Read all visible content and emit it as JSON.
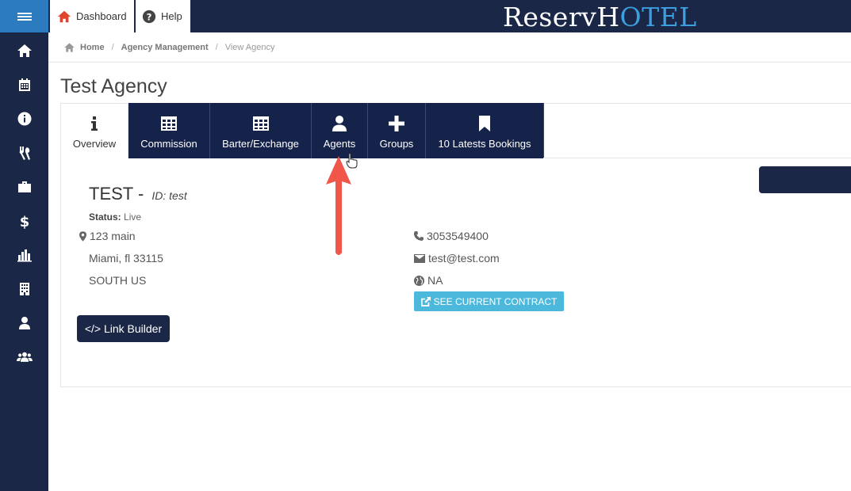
{
  "header": {
    "dashboard_label": "Dashboard",
    "help_label": "Help",
    "logo_part1": "ReservH",
    "logo_part2": "OTEL"
  },
  "sidebar": {
    "items": [
      {
        "icon": "home-icon"
      },
      {
        "icon": "calendar-icon"
      },
      {
        "icon": "info-icon"
      },
      {
        "icon": "utensils-icon"
      },
      {
        "icon": "briefcase-icon"
      },
      {
        "icon": "dollar-icon"
      },
      {
        "icon": "bar-chart-icon"
      },
      {
        "icon": "building-icon"
      },
      {
        "icon": "user-icon"
      },
      {
        "icon": "users-icon"
      }
    ]
  },
  "breadcrumb": {
    "home": "Home",
    "agency_management": "Agency Management",
    "current": "View Agency"
  },
  "page": {
    "title": "Test Agency"
  },
  "tabs": [
    {
      "label": "Overview",
      "icon": "info-icon"
    },
    {
      "label": "Commission",
      "icon": "table-icon"
    },
    {
      "label": "Barter/Exchange",
      "icon": "table-icon"
    },
    {
      "label": "Agents",
      "icon": "user-icon"
    },
    {
      "label": "Groups",
      "icon": "plus-icon"
    },
    {
      "label": "10 Latests Bookings",
      "icon": "bookmark-icon"
    }
  ],
  "agency": {
    "name": "TEST -",
    "id_text": "ID: test",
    "status_label": "Status:",
    "status_value": "Live",
    "address_line1": "123 main",
    "address_line2": "Miami, fl 33115",
    "address_line3": "SOUTH US",
    "phone": "3053549400",
    "email": "test@test.com",
    "country": "NA"
  },
  "buttons": {
    "see_contract": "SEE CURRENT CONTRACT",
    "link_builder": "</> Link Builder"
  },
  "colors": {
    "navy": "#1a2746",
    "accent_blue": "#2c7bbf",
    "contract_button": "#4cb8dc",
    "annotation_arrow": "#f0574a"
  }
}
